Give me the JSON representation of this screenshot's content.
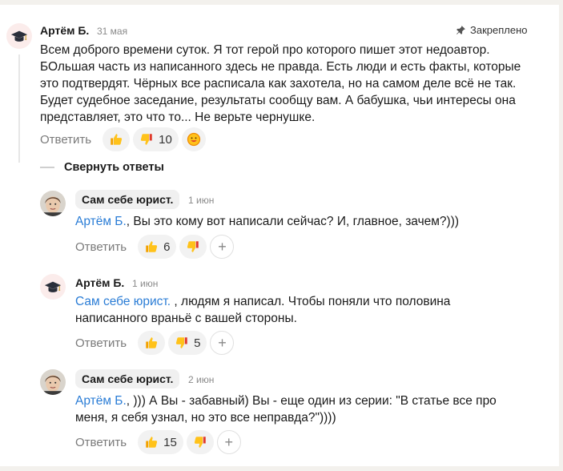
{
  "comments": [
    {
      "author": "Артём Б.",
      "date": "31 мая",
      "pinned": "Закреплено",
      "text": "Всем доброго времени суток. Я тот герой про которого пишет этот недоавтор. БОльшая часть из написанного здесь не правда. Есть люди и есть факты, которые это подтвердят. Чёрных все расписала как захотела, но на самом деле всё не так. Будет судебное заседание, результаты сообщу вам. А бабушка, чьи интересы она представляет, это что то... Не верьте чернушке.",
      "reply_label": "Ответить",
      "likes": "",
      "dislikes": "10"
    },
    {
      "author": "Сам себе юрист.",
      "date": "1 июн",
      "mention": "Артём Б.",
      "text": ", Вы это кому вот написали сейчас? И, главное, зачем?)))",
      "reply_label": "Ответить",
      "likes": "6",
      "dislikes": ""
    },
    {
      "author": "Артём Б.",
      "date": "1 июн",
      "mention": "Сам себе юрист.",
      "text": " , людям я написал. Чтобы поняли что половина написанного враньё с вашей стороны.",
      "reply_label": "Ответить",
      "likes": "",
      "dislikes": "5"
    },
    {
      "author": "Сам себе юрист.",
      "date": "2 июн",
      "mention": "Артём Б.",
      "text": ", ))) А Вы - забавный) Вы - еще один из серии: \"В статье все про меня, я себя узнал, но это все неправда?\"))))",
      "reply_label": "Ответить",
      "likes": "15",
      "dislikes": ""
    }
  ],
  "collapse_label": "Свернуть ответы",
  "icons": {
    "avatar_author": "graduation-cap-icon",
    "avatar_other": "user-photo",
    "pin": "pin-icon",
    "like": "thumbs-up-icon",
    "dislike": "thumbs-down-icon",
    "add": "plus-icon",
    "emoji": "smiley-icon"
  },
  "colors": {
    "mention": "#2b7dd6",
    "muted": "#7a7a7a",
    "pill": "#f2f2f2"
  }
}
